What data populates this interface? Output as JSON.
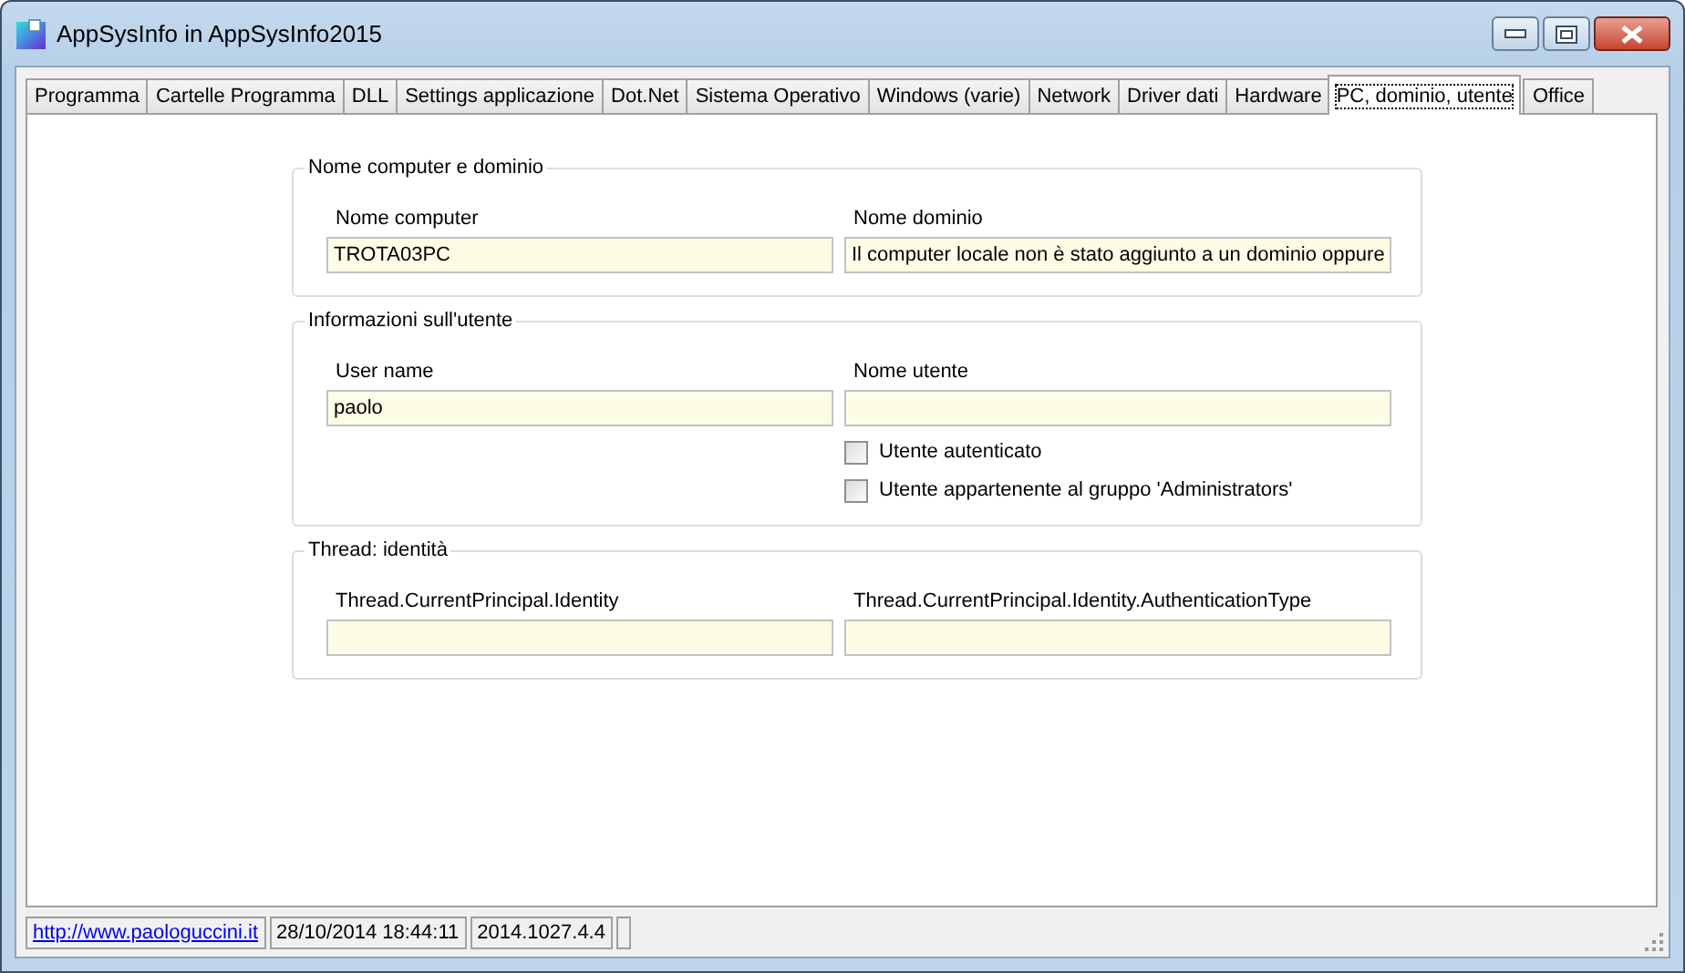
{
  "window": {
    "title": "AppSysInfo in AppSysInfo2015"
  },
  "tabs": [
    {
      "label": "Programma",
      "selected": false
    },
    {
      "label": "Cartelle Programma",
      "selected": false
    },
    {
      "label": "DLL",
      "selected": false
    },
    {
      "label": "Settings applicazione",
      "selected": false
    },
    {
      "label": "Dot.Net",
      "selected": false
    },
    {
      "label": "Sistema Operativo",
      "selected": false
    },
    {
      "label": "Windows (varie)",
      "selected": false
    },
    {
      "label": "Network",
      "selected": false
    },
    {
      "label": "Driver dati",
      "selected": false
    },
    {
      "label": "Hardware",
      "selected": false
    },
    {
      "label": "PC, dominio, utente",
      "selected": true
    },
    {
      "label": "Office",
      "selected": false
    }
  ],
  "groups": [
    {
      "title": "Nome computer e dominio",
      "fields": [
        {
          "label": "Nome computer",
          "value": "TROTA03PC"
        },
        {
          "label": "Nome dominio",
          "value": "Il computer locale non è stato aggiunto a un dominio oppure"
        }
      ]
    },
    {
      "title": "Informazioni sull'utente",
      "fields": [
        {
          "label": "User name",
          "value": "paolo"
        },
        {
          "label": "Nome utente"
        }
      ],
      "checkboxes": [
        {
          "label": "Utente autenticato",
          "checked": false
        },
        {
          "label": "Utente appartenente al gruppo 'Administrators'",
          "checked": false
        }
      ]
    },
    {
      "title": "Thread: identità",
      "fields": [
        {
          "label": "Thread.CurrentPrincipal.Identity"
        },
        {
          "label": "Thread.CurrentPrincipal.Identity.AuthenticationType"
        }
      ]
    }
  ],
  "status_bar": {
    "link": "http://www.paologuccini.it",
    "panels": [
      "28/10/2014 18:44:11",
      "2014.1027.4.4"
    ]
  }
}
